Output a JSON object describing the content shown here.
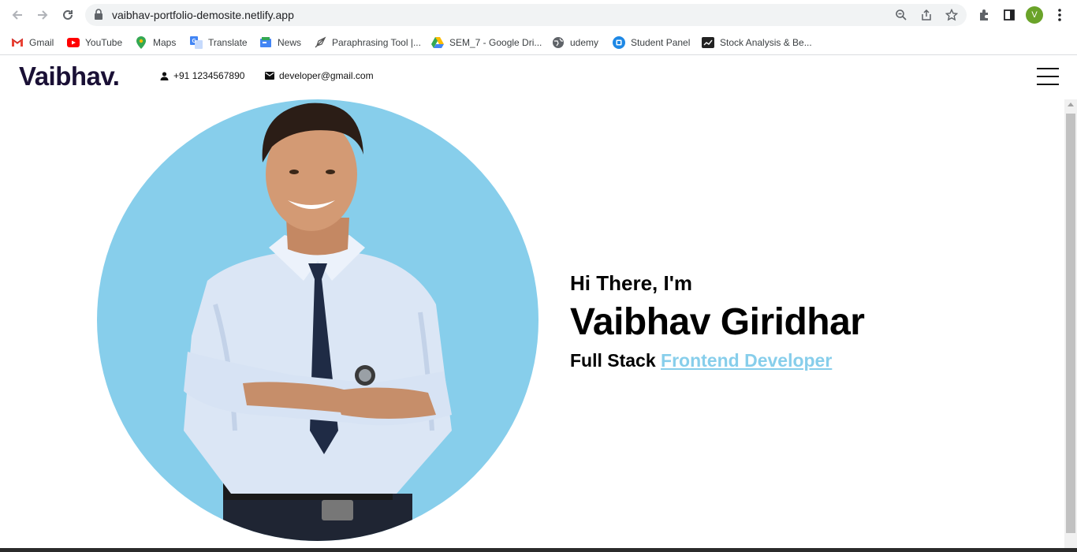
{
  "browser": {
    "url": "vaibhav-portfolio-demosite.netlify.app",
    "profile_initial": "V",
    "bookmarks": [
      {
        "label": "Gmail",
        "icon": "gmail-icon"
      },
      {
        "label": "YouTube",
        "icon": "youtube-icon"
      },
      {
        "label": "Maps",
        "icon": "maps-icon"
      },
      {
        "label": "Translate",
        "icon": "translate-icon"
      },
      {
        "label": "News",
        "icon": "news-icon"
      },
      {
        "label": "Paraphrasing Tool |...",
        "icon": "quill-icon"
      },
      {
        "label": "SEM_7 - Google Dri...",
        "icon": "drive-icon"
      },
      {
        "label": "udemy",
        "icon": "globe-icon"
      },
      {
        "label": "Student Panel",
        "icon": "student-panel-icon"
      },
      {
        "label": "Stock Analysis & Be...",
        "icon": "stock-icon"
      }
    ]
  },
  "site": {
    "logo": "Vaibhav.",
    "phone": "+91 1234567890",
    "email": "developer@gmail.com"
  },
  "hero": {
    "greeting": "Hi There, I'm",
    "name": "Vaibhav Giridhar",
    "role_prefix": "Full Stack",
    "role_highlight": "Frontend Developer"
  },
  "colors": {
    "accent": "#87ceeb",
    "logo": "#1a1035"
  }
}
